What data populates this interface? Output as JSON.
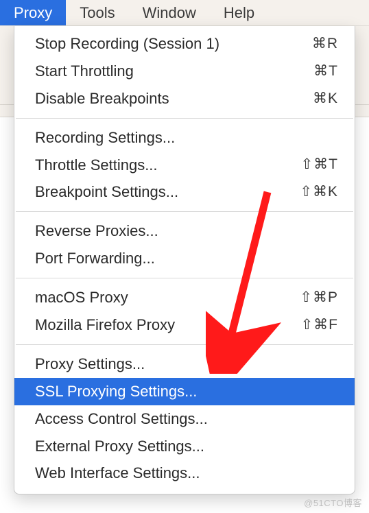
{
  "menubar": {
    "items": [
      {
        "label": "Proxy",
        "active": true
      },
      {
        "label": "Tools",
        "active": false
      },
      {
        "label": "Window",
        "active": false
      },
      {
        "label": "Help",
        "active": false
      }
    ]
  },
  "dropdown": {
    "groups": [
      [
        {
          "label": "Stop Recording (Session 1)",
          "shortcut": "⌘R"
        },
        {
          "label": "Start Throttling",
          "shortcut": "⌘T"
        },
        {
          "label": "Disable Breakpoints",
          "shortcut": "⌘K"
        }
      ],
      [
        {
          "label": "Recording Settings...",
          "shortcut": ""
        },
        {
          "label": "Throttle Settings...",
          "shortcut": "⇧⌘T"
        },
        {
          "label": "Breakpoint Settings...",
          "shortcut": "⇧⌘K"
        }
      ],
      [
        {
          "label": "Reverse Proxies...",
          "shortcut": ""
        },
        {
          "label": "Port Forwarding...",
          "shortcut": ""
        }
      ],
      [
        {
          "label": "macOS Proxy",
          "shortcut": "⇧⌘P"
        },
        {
          "label": "Mozilla Firefox Proxy",
          "shortcut": "⇧⌘F"
        }
      ],
      [
        {
          "label": "Proxy Settings...",
          "shortcut": ""
        },
        {
          "label": "SSL Proxying Settings...",
          "shortcut": "",
          "highlighted": true
        },
        {
          "label": "Access Control Settings...",
          "shortcut": ""
        },
        {
          "label": "External Proxy Settings...",
          "shortcut": ""
        },
        {
          "label": "Web Interface Settings...",
          "shortcut": ""
        }
      ]
    ]
  },
  "annotation": {
    "arrow_color": "#ff1a1a"
  },
  "watermark": "@51CTO博客"
}
